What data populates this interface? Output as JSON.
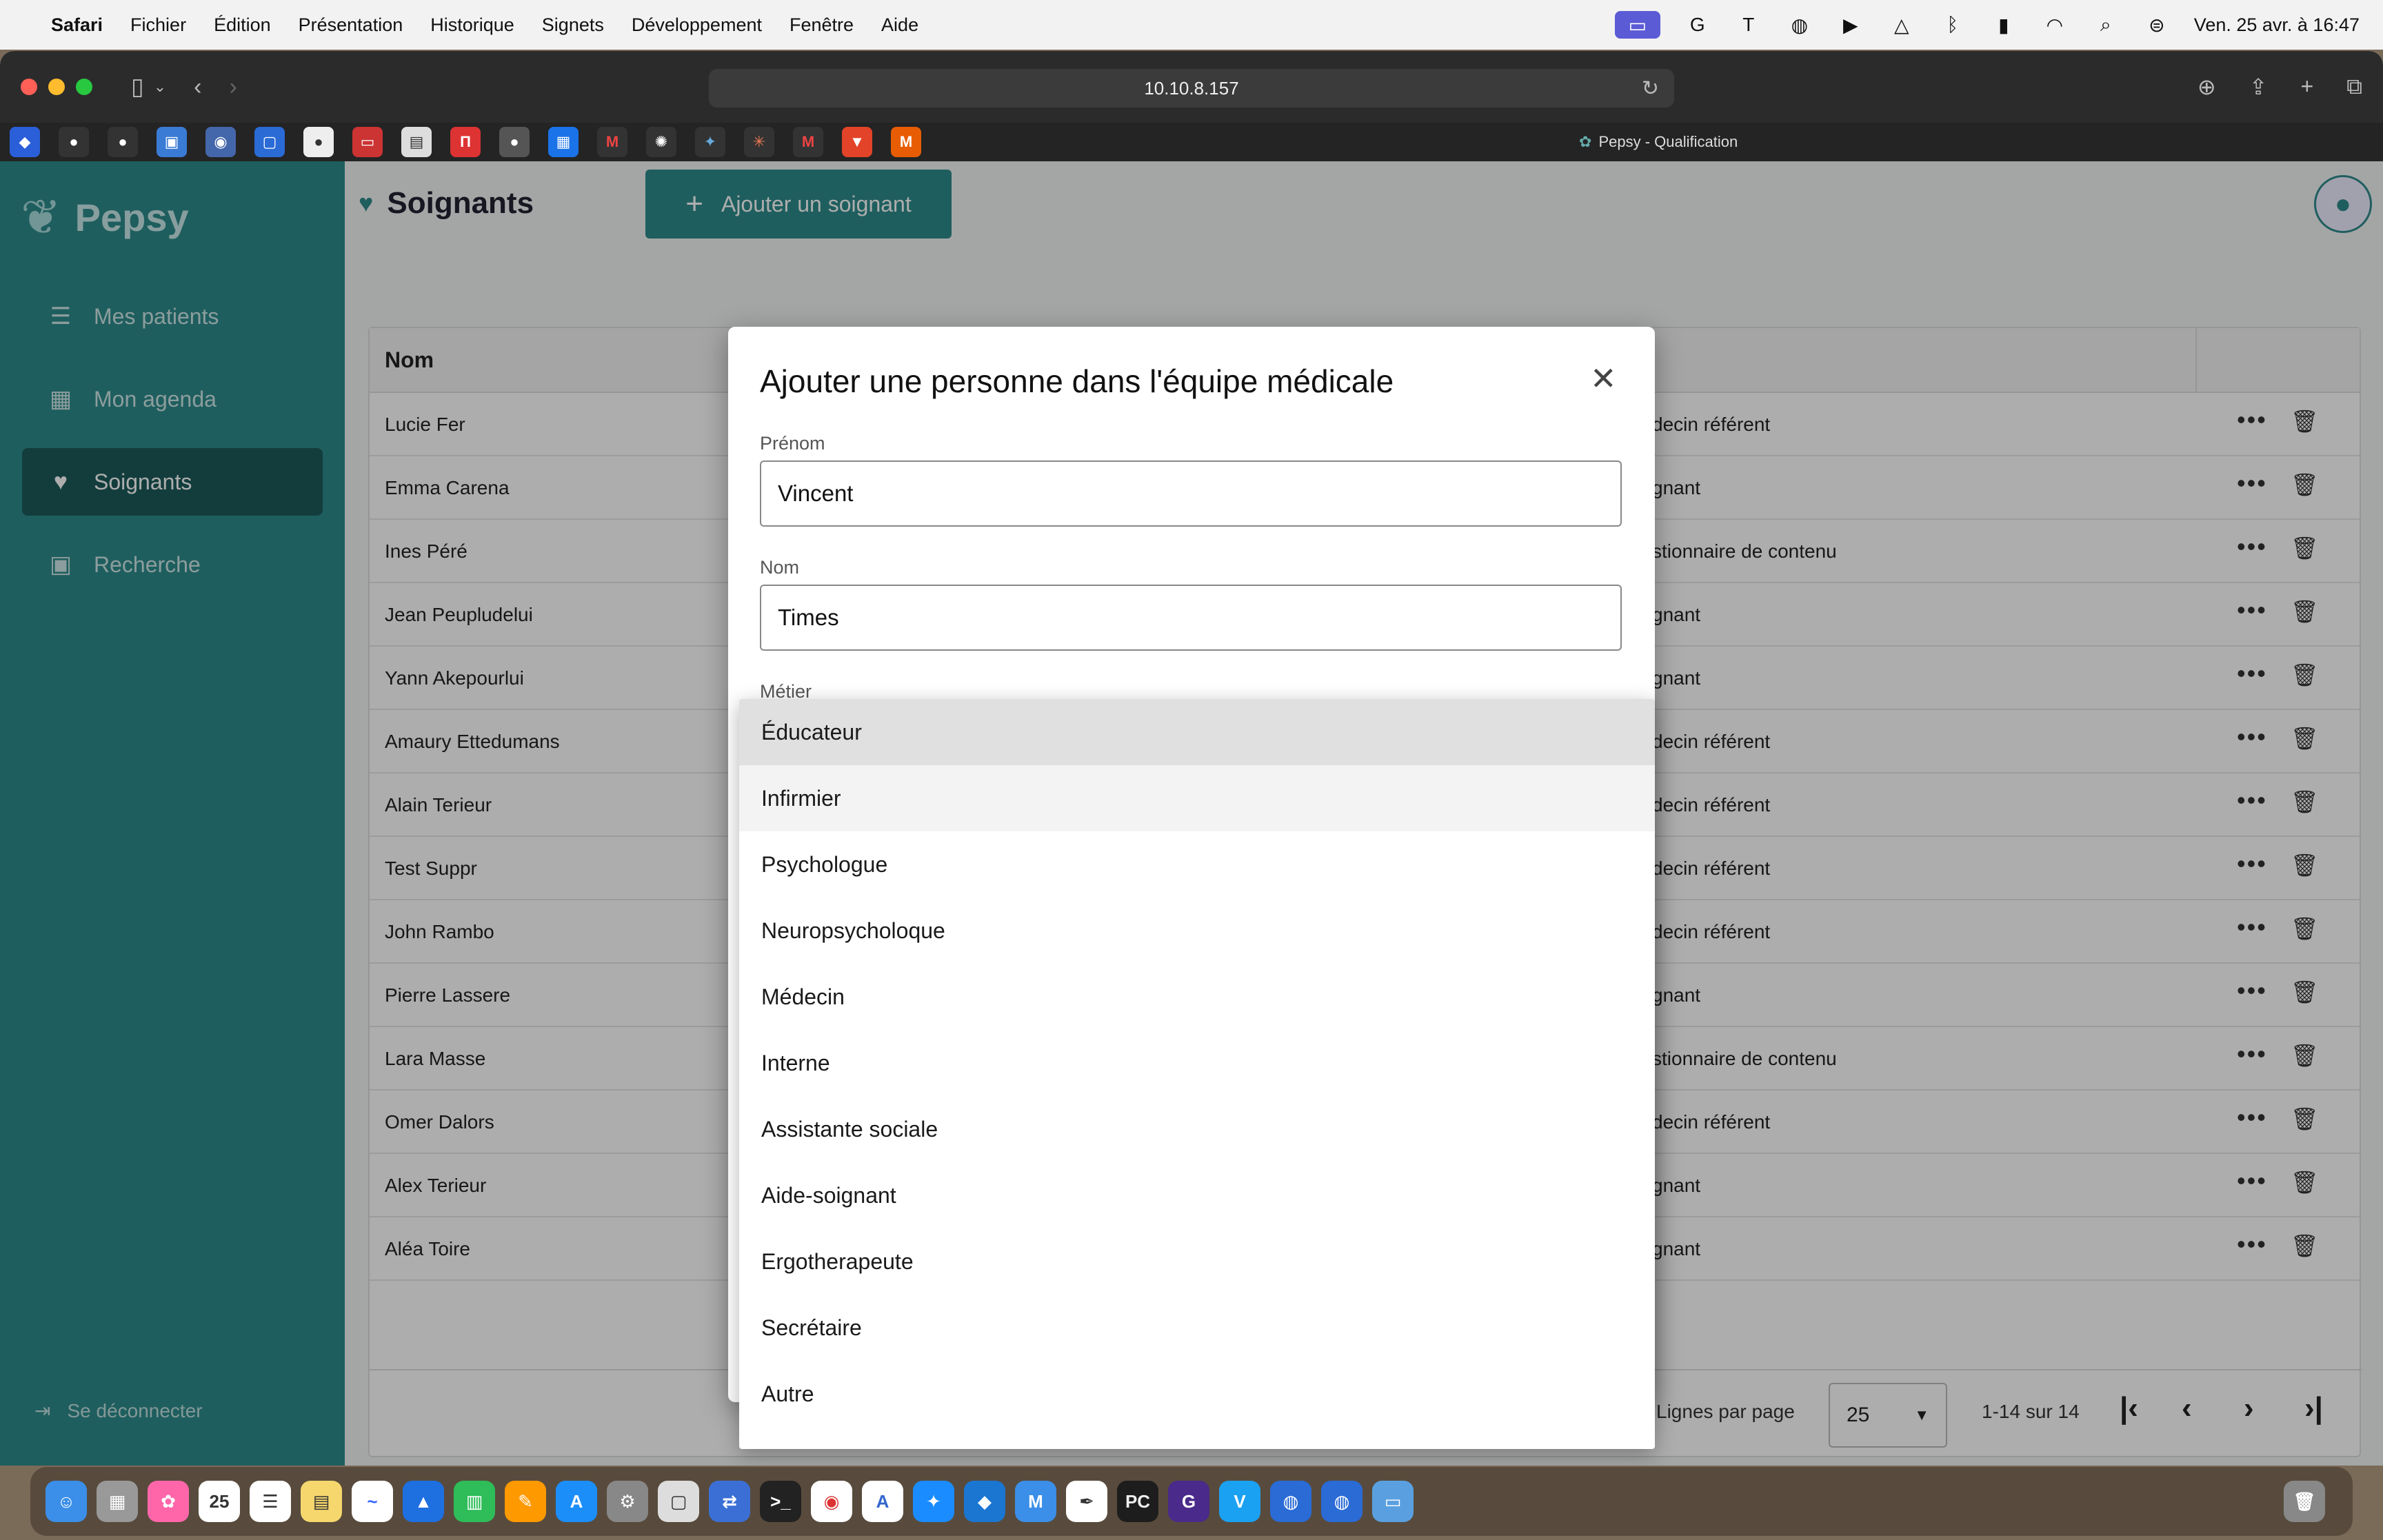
{
  "menubar": {
    "app": "Safari",
    "items": [
      "Fichier",
      "Édition",
      "Présentation",
      "Historique",
      "Signets",
      "Développement",
      "Fenêtre",
      "Aide"
    ],
    "clock": "Ven. 25 avr. à 16:47"
  },
  "browser": {
    "url": "10.10.8.157",
    "tab_title": "Pepsy - Qualification"
  },
  "app": {
    "brand": "Pepsy",
    "nav": [
      {
        "label": "Mes patients",
        "icon": "patients-list-icon"
      },
      {
        "label": "Mon agenda",
        "icon": "calendar-icon"
      },
      {
        "label": "Soignants",
        "icon": "caregiver-icon"
      },
      {
        "label": "Recherche",
        "icon": "search-book-icon"
      }
    ],
    "logout_label": "Se déconnecter",
    "page_title": "Soignants",
    "add_button_label": "Ajouter un soignant"
  },
  "table": {
    "header_name": "Nom",
    "rows": [
      {
        "name": "Lucie Fer",
        "role": "decin référent"
      },
      {
        "name": "Emma Carena",
        "role": "gnant"
      },
      {
        "name": "Ines Péré",
        "role": "stionnaire de contenu"
      },
      {
        "name": "Jean Peupludelui",
        "role": "gnant"
      },
      {
        "name": "Yann Akepourlui",
        "role": "gnant"
      },
      {
        "name": "Amaury Ettedumans",
        "role": "decin référent"
      },
      {
        "name": "Alain Terieur",
        "role": "decin référent"
      },
      {
        "name": "Test Suppr",
        "role": "decin référent"
      },
      {
        "name": "John Rambo",
        "role": "decin référent"
      },
      {
        "name": "Pierre Lassere",
        "role": "gnant"
      },
      {
        "name": "Lara Masse",
        "role": "stionnaire de contenu"
      },
      {
        "name": "Omer Dalors",
        "role": "decin référent"
      },
      {
        "name": "Alex Terieur",
        "role": "gnant"
      },
      {
        "name": "Aléa Toire",
        "role": "gnant"
      }
    ],
    "footer": {
      "rows_per_page_label": "Lignes par page",
      "rows_per_page_value": "25",
      "range": "1-14 sur 14"
    }
  },
  "dialog": {
    "title": "Ajouter une personne dans l'équipe médicale",
    "firstname_label": "Prénom",
    "firstname_value": "Vincent",
    "lastname_label": "Nom",
    "lastname_value": "Times",
    "job_label": "Métier",
    "job_options": [
      "Éducateur",
      "Infirmier",
      "Psychologue",
      "Neuropsycholoque",
      "Médecin",
      "Interne",
      "Assistante sociale",
      "Aide-soignant",
      "Ergotherapeute",
      "Secrétaire",
      "Autre"
    ],
    "selected_option": "Éducateur",
    "hovered_option": "Infirmier"
  },
  "colors": {
    "brand_teal": "#2e8b8b",
    "sidebar_active": "#1d5b5b"
  }
}
